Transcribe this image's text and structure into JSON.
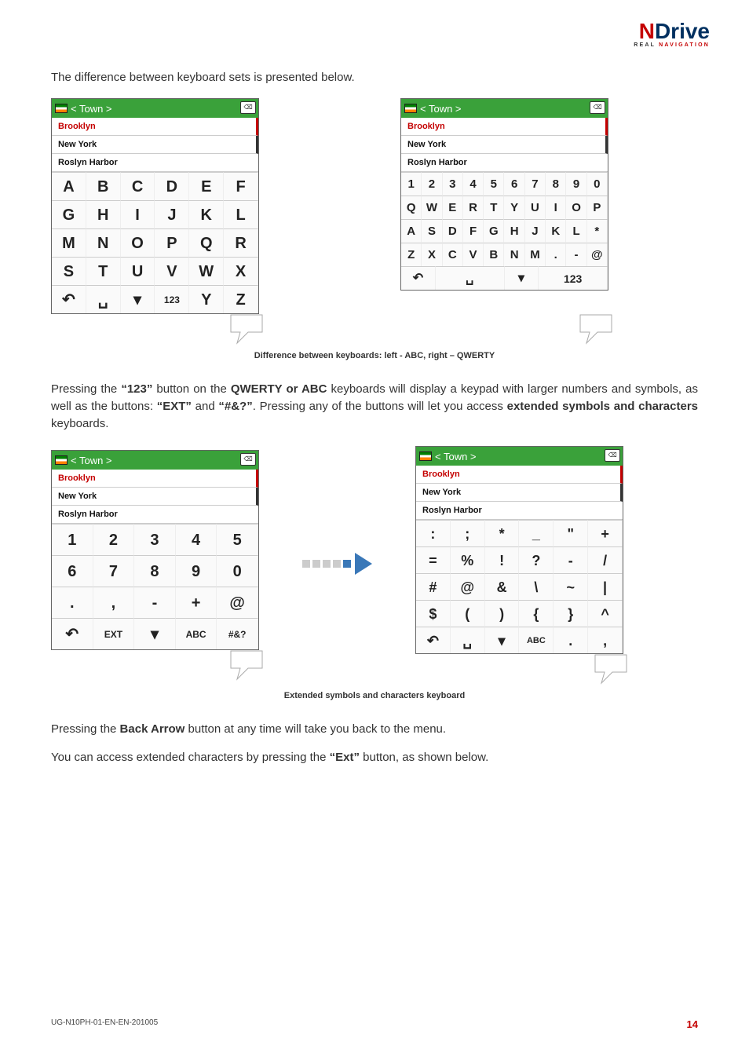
{
  "logo": {
    "word": "NDrive",
    "sub": "REAL NAVIGATION"
  },
  "intro_text": "The difference between keyboard sets is presented below.",
  "search_field": "< Town >",
  "backspace_glyph": "⌫",
  "suggestions": [
    "Brooklyn",
    "New York",
    "Roslyn Harbor"
  ],
  "kb_abc": {
    "rows": [
      [
        "A",
        "B",
        "C",
        "D",
        "E",
        "F"
      ],
      [
        "G",
        "H",
        "I",
        "J",
        "K",
        "L"
      ],
      [
        "M",
        "N",
        "O",
        "P",
        "Q",
        "R"
      ],
      [
        "S",
        "T",
        "U",
        "V",
        "W",
        "X"
      ],
      [
        "↶",
        "␣",
        "▾",
        "123",
        "Y",
        "Z"
      ]
    ]
  },
  "kb_qwerty": {
    "rows": [
      [
        "1",
        "2",
        "3",
        "4",
        "5",
        "6",
        "7",
        "8",
        "9",
        "0"
      ],
      [
        "Q",
        "W",
        "E",
        "R",
        "T",
        "Y",
        "U",
        "I",
        "O",
        "P"
      ],
      [
        "A",
        "S",
        "D",
        "F",
        "G",
        "H",
        "J",
        "K",
        "L",
        "*"
      ],
      [
        "Z",
        "X",
        "C",
        "V",
        "B",
        "N",
        "M",
        ".",
        "-",
        "@"
      ]
    ],
    "last": [
      "↶",
      "␣",
      "▾",
      "123"
    ]
  },
  "caption1": "Difference between keyboards: left - ABC, right – QWERTY",
  "para1_parts": {
    "a": "Pressing the ",
    "b": "“123”",
    "c": " button on the ",
    "d": "QWERTY or ABC",
    "e": " keyboards will display a keypad with larger numbers and symbols, as well as the buttons: ",
    "f": "“EXT”",
    "g": " and ",
    "h": "“#&?”",
    "i": ". Pressing any of the buttons will let you access ",
    "j": "extended symbols and characters",
    "k": " keyboards."
  },
  "kb_num": {
    "rows": [
      [
        "1",
        "2",
        "3",
        "4",
        "5"
      ],
      [
        "6",
        "7",
        "8",
        "9",
        "0"
      ],
      [
        ".",
        ",",
        "-",
        "+",
        "@"
      ],
      [
        "↶",
        "EXT",
        "▾",
        "ABC",
        "#&?"
      ]
    ]
  },
  "kb_sym": {
    "rows": [
      [
        ":",
        ";",
        "*",
        "_",
        "\"",
        "+"
      ],
      [
        "=",
        "%",
        "!",
        "?",
        "-",
        "/"
      ],
      [
        "#",
        "@",
        "&",
        "\\",
        "~",
        "|"
      ],
      [
        "$",
        "(",
        ")",
        "{",
        "}",
        "^"
      ],
      [
        "↶",
        "␣",
        "▾",
        "ABC",
        ".",
        ","
      ]
    ]
  },
  "caption2": "Extended symbols and characters keyboard",
  "para2_parts": {
    "a": "Pressing the ",
    "b": "Back Arrow",
    "c": " button at any time will take you back to the menu."
  },
  "para3_parts": {
    "a": "You can access extended characters by pressing the ",
    "b": "“Ext”",
    "c": " button, as shown below."
  },
  "footer_code": "UG-N10PH-01-EN-EN-201005",
  "page_number": "14"
}
